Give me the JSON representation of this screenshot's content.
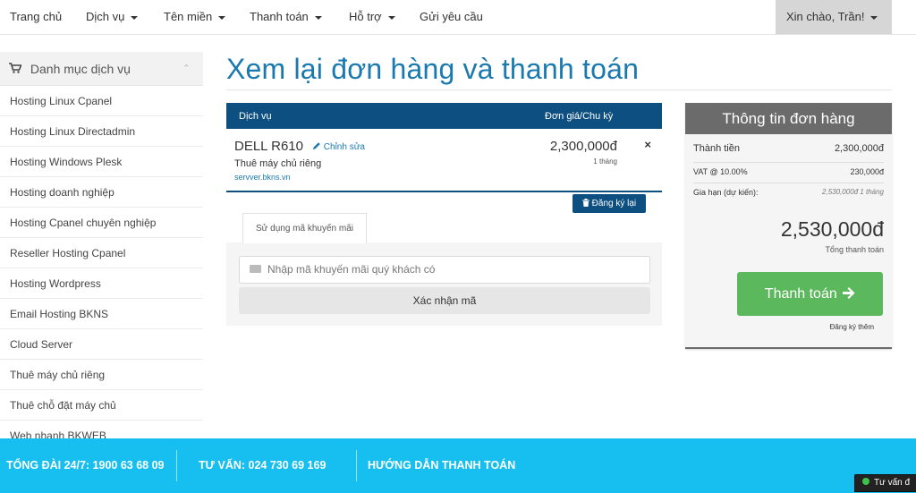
{
  "navbar": {
    "items": [
      {
        "label": "Trang chủ",
        "dropdown": false
      },
      {
        "label": "Dịch vụ",
        "dropdown": true
      },
      {
        "label": "Tên miền",
        "dropdown": true
      },
      {
        "label": "Thanh toán",
        "dropdown": true
      },
      {
        "label": "Hỗ trợ",
        "dropdown": true
      },
      {
        "label": "Gửi yêu cầu",
        "dropdown": false
      }
    ],
    "greeting": "Xin chào, Trần!"
  },
  "sidebar": {
    "title": "Danh mục dịch vụ",
    "items": [
      "Hosting Linux Cpanel",
      "Hosting Linux Directadmin",
      "Hosting Windows Plesk",
      "Hosting doanh nghiệp",
      "Hosting Cpanel chuyên nghiệp",
      "Reseller Hosting Cpanel",
      "Hosting Wordpress",
      "Email Hosting BKNS",
      "Cloud Server",
      "Thuê máy chủ riêng",
      "Thuê chỗ đặt máy chủ",
      "Web nhanh BKWEB"
    ]
  },
  "main": {
    "title": "Xem lại đơn hàng và thanh toán",
    "table": {
      "col_service": "Dịch vụ",
      "col_price": "Đơn giá/Chu kỳ"
    },
    "item": {
      "name": "DELL R610",
      "edit_label": "Chỉnh sửa",
      "category": "Thuê máy chủ riêng",
      "domain": "servver.bkns.vn",
      "price": "2,300,000đ",
      "cycle": "1 tháng",
      "remove": "×"
    },
    "renew_label": "Đăng ký lại",
    "promo": {
      "tab_label": "Sử dụng mã khuyến mãi",
      "placeholder": "Nhập mã khuyến mãi quý khách có",
      "confirm_label": "Xác nhận mã"
    }
  },
  "summary": {
    "title": "Thông tin đơn hàng",
    "lines": [
      {
        "label": "Thành tiền",
        "value": "2,300,000đ"
      },
      {
        "label": "VAT @ 10.00%",
        "value": "230,000đ"
      },
      {
        "label": "Gia hạn (dự kiến):",
        "value": "2,530,000đ 1 tháng"
      }
    ],
    "total": "2,530,000đ",
    "total_label": "Tổng thanh toán",
    "pay_label": "Thanh toán",
    "more_label": "Đăng ký thêm"
  },
  "footer": {
    "hotline": "TỔNG ĐÀI 24/7: 1900 63 68 09",
    "consult": "TƯ VẤN: 024 730 69 169",
    "guide": "HƯỚNG DẪN THANH TOÁN",
    "chat_label": "Tư vấn đ"
  },
  "colors": {
    "brand_blue": "#0d4f80",
    "title_blue": "#1a7ab0",
    "pay_green": "#5cb85c",
    "footer_cyan": "#16bfef",
    "summary_gray": "#6b6b6b"
  },
  "icons": [
    "shopping-cart-icon",
    "chevron-up-icon",
    "pencil-icon",
    "trash-icon",
    "keyboard-icon",
    "arrow-right-icon",
    "caret-down-icon",
    "online-dot-icon"
  ]
}
